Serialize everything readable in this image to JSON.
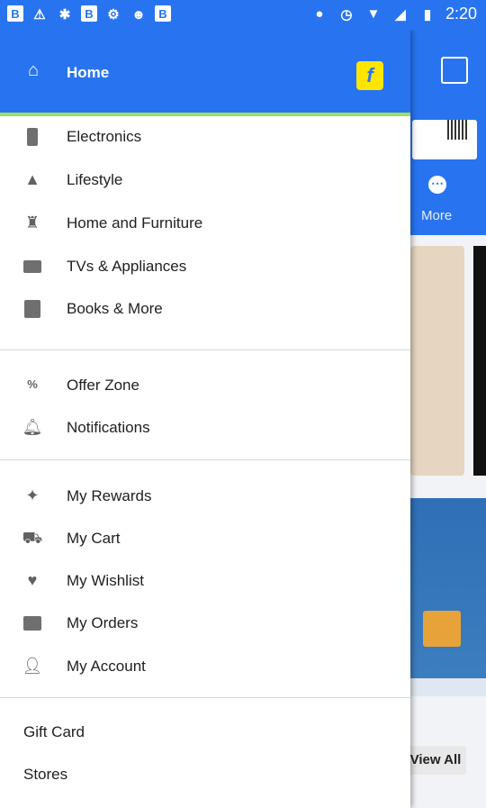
{
  "status_bar": {
    "time": "2:20",
    "left_icons": [
      "notification-b-icon",
      "alert-icon",
      "photos-icon",
      "b-icon",
      "gear-icon",
      "cat-icon",
      "b-icon"
    ],
    "right_icons": [
      "location-icon",
      "alarm-icon",
      "wifi-icon",
      "no-signal-icon",
      "battery-icon"
    ]
  },
  "drawer": {
    "header": {
      "home_label": "Home",
      "logo_letter": "f"
    },
    "section1": [
      {
        "label": "Electronics",
        "icon": "phone-icon"
      },
      {
        "label": "Lifestyle",
        "icon": "shirt-icon"
      },
      {
        "label": "Home and Furniture",
        "icon": "lamp-icon"
      },
      {
        "label": "TVs & Appliances",
        "icon": "monitor-icon"
      },
      {
        "label": "Books & More",
        "icon": "book-icon"
      }
    ],
    "section2": [
      {
        "label": "Offer Zone",
        "icon": "percent-icon"
      },
      {
        "label": "Notifications",
        "icon": "bell-icon"
      }
    ],
    "section3": [
      {
        "label": "My Rewards",
        "icon": "rewards-icon"
      },
      {
        "label": "My Cart",
        "icon": "cart-icon"
      },
      {
        "label": "My Wishlist",
        "icon": "heart-icon"
      },
      {
        "label": "My Orders",
        "icon": "orders-icon"
      },
      {
        "label": "My Account",
        "icon": "account-icon"
      }
    ],
    "section4": [
      {
        "label": "Gift Card"
      },
      {
        "label": "Stores"
      }
    ]
  },
  "background": {
    "more_label": "More",
    "view_all_label": "View All"
  },
  "colors": {
    "primary": "#2874f0",
    "accent": "#9be15d",
    "logo_yellow": "#ffe500"
  }
}
